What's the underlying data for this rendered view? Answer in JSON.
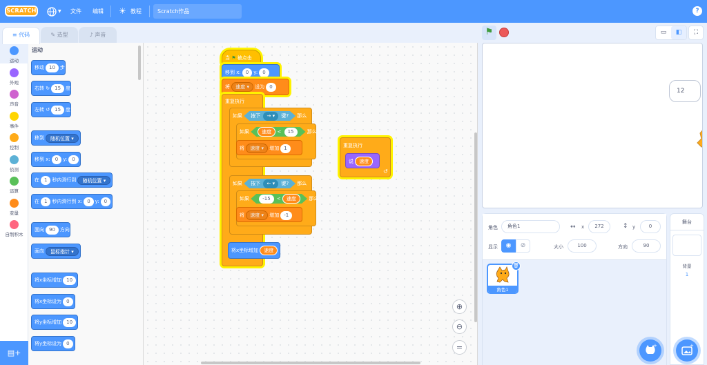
{
  "menubar": {
    "logo": "SCRATCH",
    "file": "文件",
    "edit": "编辑",
    "tutorials": "教程",
    "project_title": "Scratch作品"
  },
  "tabs": {
    "code": "代码",
    "costumes": "造型",
    "sounds": "声音"
  },
  "categories": [
    {
      "label": "运动",
      "color": "#4c97ff"
    },
    {
      "label": "外观",
      "color": "#9966ff"
    },
    {
      "label": "声音",
      "color": "#cf63cf"
    },
    {
      "label": "事件",
      "color": "#ffd500"
    },
    {
      "label": "控制",
      "color": "#ffab19"
    },
    {
      "label": "侦测",
      "color": "#5cb1d6"
    },
    {
      "label": "运算",
      "color": "#59c059"
    },
    {
      "label": "变量",
      "color": "#ff8c1a"
    },
    {
      "label": "自制积木",
      "color": "#ff6680"
    }
  ],
  "palette": {
    "heading": "运动",
    "move": {
      "a": "移动",
      "v": "10",
      "b": "步"
    },
    "turn_right": {
      "a": "右转",
      "v": "15",
      "b": "度"
    },
    "turn_left": {
      "a": "左转",
      "v": "15",
      "b": "度"
    },
    "goto": {
      "a": "移到",
      "d": "随机位置"
    },
    "goto_xy": {
      "a": "移到 x:",
      "x": "0",
      "b": "y:",
      "y": "0"
    },
    "glide": {
      "a": "在",
      "v": "1",
      "b": "秒内滑行到",
      "d": "随机位置"
    },
    "glide_xy": {
      "a": "在",
      "v": "1",
      "b": "秒内滑行到 x:",
      "x": "0",
      "c": "y:",
      "y": "0"
    },
    "point": {
      "a": "面向",
      "v": "90",
      "b": "方向"
    },
    "point_towards": {
      "a": "面向",
      "d": "鼠标指针"
    },
    "change_x": {
      "a": "将x坐标增加",
      "v": "10"
    },
    "set_x": {
      "a": "将x坐标设为",
      "v": "0"
    },
    "change_y": {
      "a": "将y坐标增加",
      "v": "10"
    },
    "set_y": {
      "a": "将y坐标设为",
      "v": "0"
    }
  },
  "script1": {
    "hat_a": "当",
    "hat_b": "被点击",
    "goto_a": "移到 x:",
    "goto_x": "0",
    "goto_b": "y:",
    "goto_y": "0",
    "setvar_a": "将",
    "setvar_var": "速度",
    "setvar_b": "设为",
    "setvar_v": "0",
    "forever": "重复执行",
    "if1_a": "如果",
    "if1_key": "按下",
    "if1_keyval": "→",
    "if1_key2": "键?",
    "if1_then": "那么",
    "if2_a": "如果",
    "if2_var": "速度",
    "if2_op": "<",
    "if2_v": "15",
    "if2_then": "那么",
    "chg1_a": "将",
    "chg1_var": "速度",
    "chg1_b": "增加",
    "chg1_v": "1",
    "if3_a": "如果",
    "if3_key": "按下",
    "if3_keyval": "←",
    "if3_key2": "键?",
    "if3_then": "那么",
    "if4_a": "如果",
    "if4_v": "-15",
    "if4_op": "<",
    "if4_var": "速度",
    "if4_then": "那么",
    "chg2_a": "将",
    "chg2_var": "速度",
    "chg2_b": "增加",
    "chg2_v": "-1",
    "chgx_a": "将x坐标增加",
    "chgx_var": "速度"
  },
  "script2": {
    "forever": "重复执行",
    "say": "说",
    "say_var": "速度"
  },
  "stage": {
    "bubble": "12"
  },
  "sprite_info": {
    "sprite_label": "角色",
    "sprite_name": "角色1",
    "x_label": "x",
    "x": "272",
    "y_label": "y",
    "y": "0",
    "show_label": "显示",
    "size_label": "大小",
    "size": "100",
    "dir_label": "方向",
    "dir": "90"
  },
  "sprite_thumb": {
    "name": "角色1"
  },
  "backdrop": {
    "title": "舞台",
    "label": "背景",
    "count": "1"
  }
}
